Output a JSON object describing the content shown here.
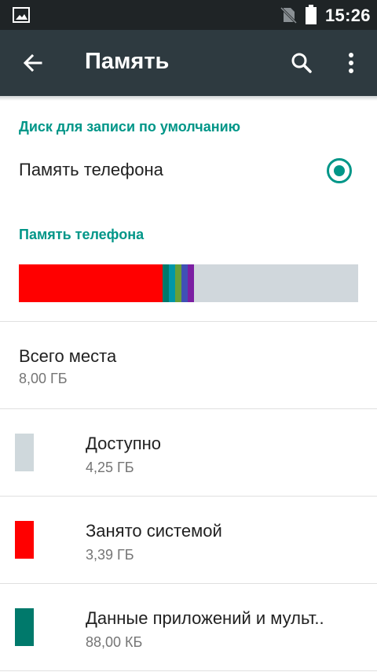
{
  "status_bar": {
    "time": "15:26",
    "icons": [
      "image-icon",
      "no-sim-icon",
      "battery-icon"
    ]
  },
  "toolbar": {
    "title": "Память",
    "back_icon": "arrow-back-icon",
    "search_icon": "search-icon",
    "more_icon": "more-vert-icon"
  },
  "default_disk": {
    "header": "Диск для записи по умолчанию",
    "option_label": "Память телефона",
    "selected": true
  },
  "phone_storage": {
    "header": "Память телефона",
    "usage_bar": {
      "total_gb": 8.0,
      "segments": [
        {
          "name": "system",
          "color": "#ff0000",
          "fraction": 0.4238
        },
        {
          "name": "apps-media",
          "color": "#00796b",
          "fraction": 0.0185
        },
        {
          "name": "segment-3",
          "color": "#0097a7",
          "fraction": 0.0185
        },
        {
          "name": "segment-4",
          "color": "#689f38",
          "fraction": 0.0185
        },
        {
          "name": "segment-5",
          "color": "#3f51b5",
          "fraction": 0.0185
        },
        {
          "name": "segment-6",
          "color": "#7b1fa2",
          "fraction": 0.0185
        }
      ],
      "free_color": "#d0d7dc"
    },
    "total": {
      "label": "Всего места",
      "value": "8,00 ГБ"
    },
    "items": [
      {
        "label": "Доступно",
        "value": "4,25 ГБ",
        "color": "#cfd8dc"
      },
      {
        "label": "Занято системой",
        "value": "3,39 ГБ",
        "color": "#ff0000"
      },
      {
        "label": "Данные приложений и мульт..",
        "value": "88,00 КБ",
        "color": "#00796b"
      }
    ]
  }
}
